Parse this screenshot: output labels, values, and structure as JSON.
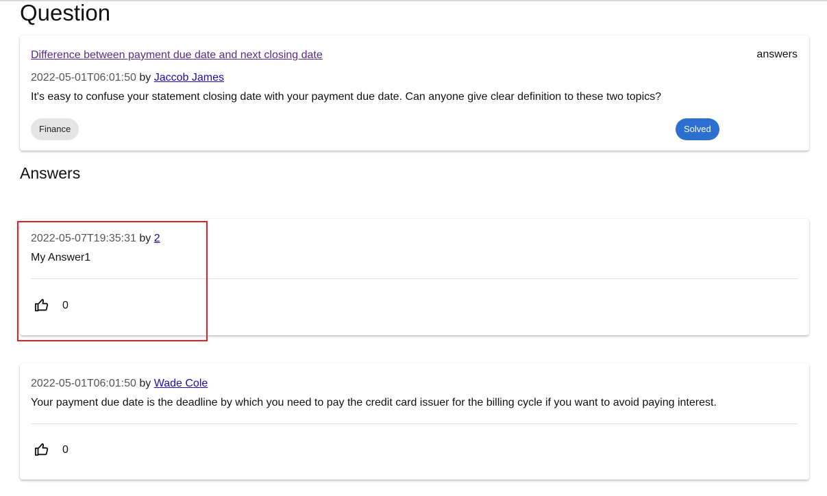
{
  "page": {
    "title": "Question"
  },
  "question": {
    "title": "Difference between payment due date and next closing date",
    "answers_label": "answers",
    "date": "2022-05-01T06:01:50",
    "by": "by",
    "author": "Jaccob James",
    "body": "It's easy to confuse your statement closing date with your payment due date. Can anyone give clear definition to these two topics?",
    "tag": "Finance",
    "status": "Solved",
    "colors": {
      "status": "#2b6fd1",
      "tag_bg": "#e4e4e4",
      "title_link": "#5a2a8a"
    }
  },
  "answers_section": {
    "title": "Answers"
  },
  "answers": [
    {
      "date": "2022-05-07T19:35:31",
      "by": "by",
      "author": "2",
      "body": "My Answer1",
      "likes": "0",
      "like_icon": "thumb-up-icon",
      "highlighted": true
    },
    {
      "date": "2022-05-01T06:01:50",
      "by": "by",
      "author": "Wade Cole",
      "body": "Your payment due date is the deadline by which you need to pay the credit card issuer for the billing cycle if you want to avoid paying interest.",
      "likes": "0",
      "like_icon": "thumb-up-icon"
    }
  ],
  "colors": {
    "highlight_border": "#e01f2a",
    "link": "#1a0dab"
  }
}
